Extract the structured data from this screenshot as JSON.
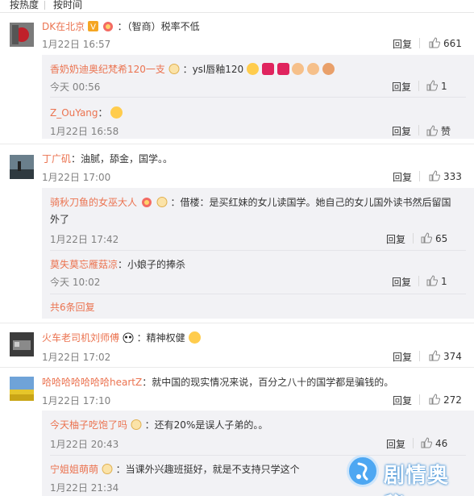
{
  "sort": {
    "hot": "按热度",
    "time": "按时间"
  },
  "comments": [
    {
      "user": "DK在北京",
      "text": "：（智商）税率不低",
      "time": "1月22日 16:57",
      "reply": "回复",
      "likes": "661",
      "replies": [
        {
          "user": "香奶奶迪奥纪梵希120一支",
          "text": "：ysl唇釉120",
          "time": "今天 00:56",
          "reply": "回复",
          "likes": "1"
        },
        {
          "user": "Z_OuYang",
          "text": "：",
          "time": "1月22日 16:58",
          "reply": "回复",
          "likes": "赞"
        }
      ]
    },
    {
      "user": "丁广矶",
      "text": "：油腻，舔金，国学。。",
      "time": "1月22日 17:00",
      "reply": "回复",
      "likes": "333",
      "replies": [
        {
          "user": "骑秋刀鱼的女巫大人",
          "text": "：借楼：是买红妹的女儿读国学。她自己的女儿国外读书然后留国",
          "text2": "外了",
          "time": "1月22日 17:42",
          "reply": "回复",
          "likes": "65"
        },
        {
          "user": "莫失莫忘雁菇凉",
          "text": "：小娘子的捧杀",
          "time": "今天 10:02",
          "reply": "回复",
          "likes": "1"
        }
      ],
      "more": "共6条回复"
    },
    {
      "user": "火车老司机刘师傅",
      "text": "：精神权健",
      "time": "1月22日 17:02",
      "reply": "回复",
      "likes": "374"
    },
    {
      "user": "哈哈哈哈哈哈哈heartZ",
      "text": "：就中国的现实情况来说，百分之八十的国学都是骗钱的。",
      "time": "1月22日 17:10",
      "reply": "回复",
      "likes": "272",
      "replies": [
        {
          "user": "今天柚子吃饱了吗",
          "text": "：还有20%是误人子弟的。。",
          "time": "1月22日 20:43",
          "reply": "回复",
          "likes": "46"
        },
        {
          "user": "宁姐姐萌萌",
          "text": "：当课外兴趣班挺好，就是不支持只学这个",
          "time": "1月22日 21:34",
          "reply": "回复",
          "likes": ""
        }
      ]
    }
  ],
  "watermark": "剧情奥秘",
  "colors": {
    "username": "#eb7350",
    "subbox": "#f2f2f5",
    "muted": "#808080"
  }
}
